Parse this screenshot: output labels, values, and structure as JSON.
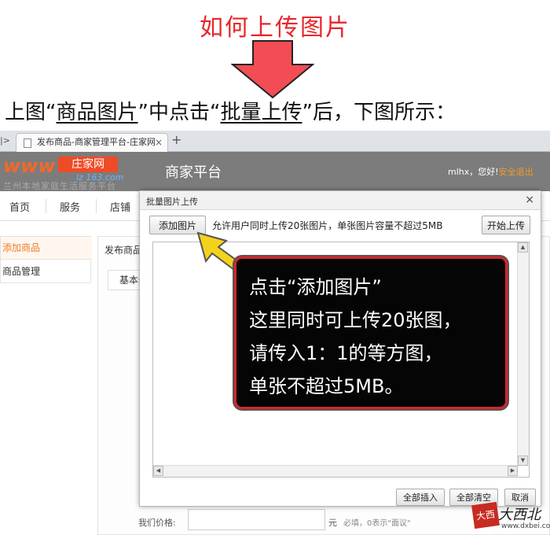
{
  "tutorial": {
    "title": "如何上传图片",
    "instruction_1": "上图“",
    "instruction_link_1": "商品图片",
    "instruction_2": "”中点击“",
    "instruction_link_2": "批量上传",
    "instruction_3": "”后，下图所示：",
    "accent_color": "#e8262b"
  },
  "browser": {
    "nav_arrows": "|>",
    "tab_title": "发布商品-商家管理平台-庄家网",
    "tab_close": "×",
    "new_tab": "+"
  },
  "site_header": {
    "logo_www": "www",
    "logo_brand": "庄家网",
    "logo_sub": "lz 163.com",
    "tagline": "兰州本地家庭生活服务平台",
    "platform_name": "商家平台",
    "user_greeting": "mlhx，您好!",
    "logout_label": "安全退出"
  },
  "nav": {
    "items": [
      "首页",
      "服务",
      "店铺"
    ]
  },
  "sidebar": {
    "items": [
      "添加商品",
      "商品管理"
    ],
    "active_color": "#f07a23"
  },
  "main": {
    "title": "发布商品",
    "tab_label": "基本信",
    "price_label": "我们价格:",
    "price_unit": "元",
    "price_hint": "必填，0表示\"面议\""
  },
  "dialog": {
    "title": "批量图片上传",
    "close": "×",
    "add_button": "添加图片",
    "upload_limit_text": "允许用户同时上传20张图片，单张图片容量不超过5MB",
    "start_button": "开始上传",
    "insert_all_button": "全部插入",
    "clear_all_button": "全部清空",
    "cancel_button": "取消",
    "scroll_up": "▲",
    "scroll_down": "▼",
    "scroll_left": "◀",
    "scroll_right": "▶"
  },
  "callout": {
    "lines": [
      "点击“添加图片”",
      "这里同时可上传20张图，",
      "请传入1：1的等方图，",
      "单张不超过5MB。"
    ],
    "border_color": "#d4252b",
    "arrow_color": "#f4d21c"
  },
  "watermark": {
    "seal": "大西北",
    "text": "大西北",
    "url": "www.dxbei.com"
  }
}
